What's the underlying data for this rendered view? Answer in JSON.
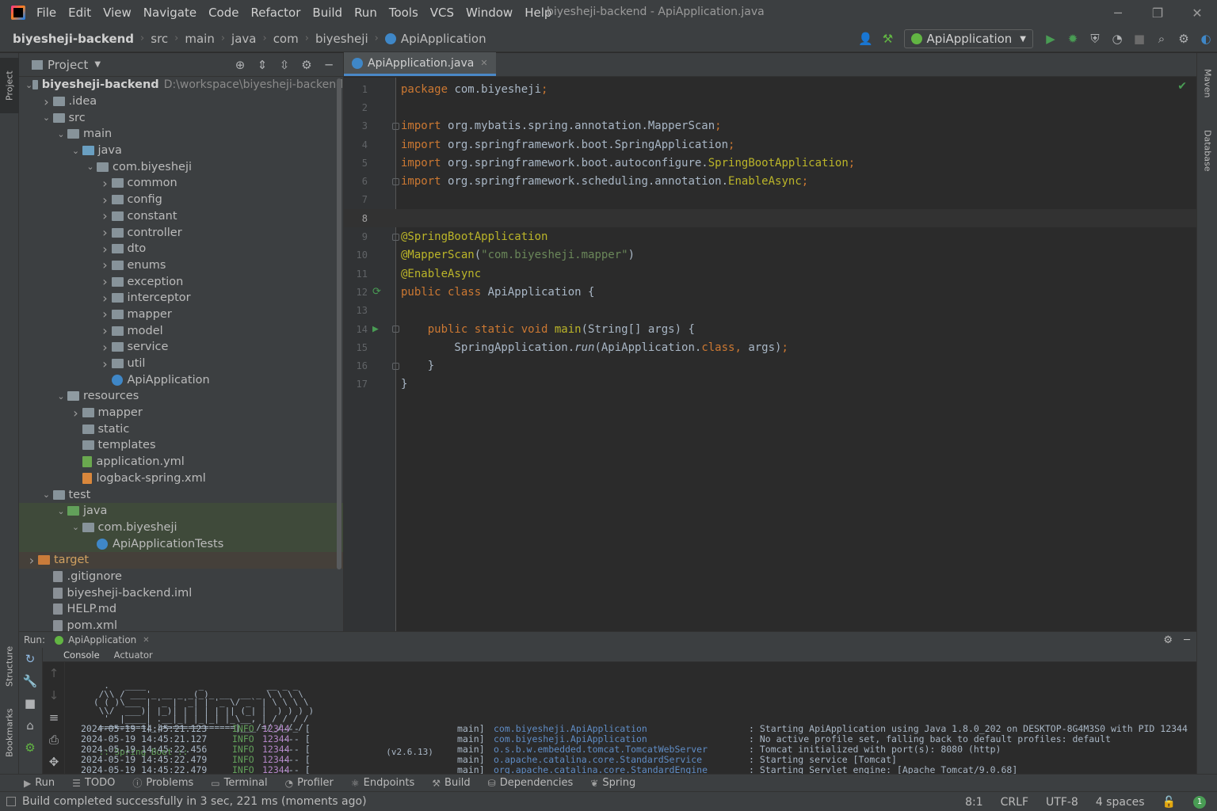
{
  "menubar": {
    "items": [
      "File",
      "Edit",
      "View",
      "Navigate",
      "Code",
      "Refactor",
      "Build",
      "Run",
      "Tools",
      "VCS",
      "Window",
      "Help"
    ],
    "window_title": "biyesheji-backend - ApiApplication.java"
  },
  "navbar": {
    "breadcrumbs": [
      "biyesheji-backend",
      "src",
      "main",
      "java",
      "com",
      "biyesheji",
      "ApiApplication"
    ],
    "run_config": "ApiApplication"
  },
  "project": {
    "title": "Project",
    "root_path": "D:\\workspace\\biyesheji-backend",
    "tree": [
      {
        "label": "biyesheji-backend",
        "depth": 0,
        "arrow": "v",
        "icon": "folder",
        "bold": true
      },
      {
        "label": ".idea",
        "depth": 1,
        "arrow": ">",
        "icon": "folder"
      },
      {
        "label": "src",
        "depth": 1,
        "arrow": "v",
        "icon": "folder"
      },
      {
        "label": "main",
        "depth": 2,
        "arrow": "v",
        "icon": "folder"
      },
      {
        "label": "java",
        "depth": 3,
        "arrow": "v",
        "icon": "folder-src"
      },
      {
        "label": "com.biyesheji",
        "depth": 4,
        "arrow": "v",
        "icon": "package"
      },
      {
        "label": "common",
        "depth": 5,
        "arrow": ">",
        "icon": "package"
      },
      {
        "label": "config",
        "depth": 5,
        "arrow": ">",
        "icon": "package"
      },
      {
        "label": "constant",
        "depth": 5,
        "arrow": ">",
        "icon": "package"
      },
      {
        "label": "controller",
        "depth": 5,
        "arrow": ">",
        "icon": "package"
      },
      {
        "label": "dto",
        "depth": 5,
        "arrow": ">",
        "icon": "package"
      },
      {
        "label": "enums",
        "depth": 5,
        "arrow": ">",
        "icon": "package"
      },
      {
        "label": "exception",
        "depth": 5,
        "arrow": ">",
        "icon": "package"
      },
      {
        "label": "interceptor",
        "depth": 5,
        "arrow": ">",
        "icon": "package"
      },
      {
        "label": "mapper",
        "depth": 5,
        "arrow": ">",
        "icon": "package"
      },
      {
        "label": "model",
        "depth": 5,
        "arrow": ">",
        "icon": "package"
      },
      {
        "label": "service",
        "depth": 5,
        "arrow": ">",
        "icon": "package"
      },
      {
        "label": "util",
        "depth": 5,
        "arrow": ">",
        "icon": "package"
      },
      {
        "label": "ApiApplication",
        "depth": 5,
        "arrow": "",
        "icon": "spring-class"
      },
      {
        "label": "resources",
        "depth": 2,
        "arrow": "v",
        "icon": "folder-res"
      },
      {
        "label": "mapper",
        "depth": 3,
        "arrow": ">",
        "icon": "folder"
      },
      {
        "label": "static",
        "depth": 3,
        "arrow": "",
        "icon": "folder"
      },
      {
        "label": "templates",
        "depth": 3,
        "arrow": "",
        "icon": "folder"
      },
      {
        "label": "application.yml",
        "depth": 3,
        "arrow": "",
        "icon": "yml"
      },
      {
        "label": "logback-spring.xml",
        "depth": 3,
        "arrow": "",
        "icon": "xml"
      },
      {
        "label": "test",
        "depth": 1,
        "arrow": "v",
        "icon": "folder"
      },
      {
        "label": "java",
        "depth": 2,
        "arrow": "v",
        "icon": "folder-test",
        "sel": true
      },
      {
        "label": "com.biyesheji",
        "depth": 3,
        "arrow": "v",
        "icon": "package",
        "sel": true
      },
      {
        "label": "ApiApplicationTests",
        "depth": 4,
        "arrow": "",
        "icon": "class",
        "sel": true
      },
      {
        "label": "target",
        "depth": 0,
        "arrow": ">",
        "icon": "folder-excl",
        "excl": true
      },
      {
        "label": ".gitignore",
        "depth": 1,
        "arrow": "",
        "icon": "file"
      },
      {
        "label": "biyesheji-backend.iml",
        "depth": 1,
        "arrow": "",
        "icon": "file"
      },
      {
        "label": "HELP.md",
        "depth": 1,
        "arrow": "",
        "icon": "file"
      },
      {
        "label": "pom.xml",
        "depth": 1,
        "arrow": "",
        "icon": "file"
      }
    ]
  },
  "editor": {
    "tab_label": "ApiApplication.java",
    "current_line": 8,
    "lines": [
      [
        {
          "t": "package ",
          "c": "kw"
        },
        {
          "t": "com.biyesheji",
          "c": "plain"
        },
        {
          "t": ";",
          "c": "kw"
        }
      ],
      [],
      [
        {
          "t": "import ",
          "c": "kw"
        },
        {
          "t": "org.mybatis.spring.annotation.MapperScan",
          "c": "plain"
        },
        {
          "t": ";",
          "c": "kw"
        }
      ],
      [
        {
          "t": "import ",
          "c": "kw"
        },
        {
          "t": "org.springframework.boot.SpringApplication",
          "c": "plain"
        },
        {
          "t": ";",
          "c": "kw"
        }
      ],
      [
        {
          "t": "import ",
          "c": "kw"
        },
        {
          "t": "org.springframework.boot.autoconfigure.",
          "c": "plain"
        },
        {
          "t": "SpringBootApplication",
          "c": "ann"
        },
        {
          "t": ";",
          "c": "kw"
        }
      ],
      [
        {
          "t": "import ",
          "c": "kw"
        },
        {
          "t": "org.springframework.scheduling.annotation.",
          "c": "plain"
        },
        {
          "t": "EnableAsync",
          "c": "ann"
        },
        {
          "t": ";",
          "c": "kw"
        }
      ],
      [],
      [],
      [
        {
          "t": "@SpringBootApplication",
          "c": "ann"
        }
      ],
      [
        {
          "t": "@MapperScan",
          "c": "ann"
        },
        {
          "t": "(",
          "c": "plain"
        },
        {
          "t": "\"com.biyesheji.mapper\"",
          "c": "str"
        },
        {
          "t": ")",
          "c": "plain"
        }
      ],
      [
        {
          "t": "@EnableAsync",
          "c": "ann"
        }
      ],
      [
        {
          "t": "public class ",
          "c": "kw"
        },
        {
          "t": "ApiApplication {",
          "c": "plain"
        }
      ],
      [],
      [
        {
          "t": "    public static void ",
          "c": "kw"
        },
        {
          "t": "main",
          "c": "ann"
        },
        {
          "t": "(String[] args) {",
          "c": "plain"
        }
      ],
      [
        {
          "t": "        SpringApplication.",
          "c": "plain"
        },
        {
          "t": "run",
          "c": "plain ital"
        },
        {
          "t": "(ApiApplication.",
          "c": "plain"
        },
        {
          "t": "class",
          "c": "kw"
        },
        {
          "t": ", ",
          "c": "kw"
        },
        {
          "t": "args)",
          "c": "plain"
        },
        {
          "t": ";",
          "c": "kw"
        }
      ],
      [
        {
          "t": "    }",
          "c": "plain"
        }
      ],
      [
        {
          "t": "}",
          "c": "plain"
        }
      ]
    ]
  },
  "run": {
    "label": "Run:",
    "config_tab": "ApiApplication",
    "subtabs": [
      "Console",
      "Actuator"
    ],
    "banner": "  .   ____          _            __ _ _\n /\\\\ / ___'_ __ _ _(_)_ __  __ _ \\ \\ \\ \\\n( ( )\\___ | '_ | '_| | '_ \\/ _` | \\ \\ \\ \\\n \\\\/  ___)| |_)| | | | | || (_| |  ) ) ) )\n  '  |____| .__|_| |_|_| |_\\__, | / / / /\n =========|_|==============|___/=/_/_/_/",
    "banner_label": " :: Spring Boot ::",
    "banner_version": "(v2.6.13)",
    "logs": [
      {
        "ts": "2024-05-19 14:45:21.123",
        "lvl": "INFO",
        "pid": "12344",
        "sep": "--- [",
        "thr": "main]",
        "logger": "com.biyesheji.ApiApplication",
        "msg": ": Starting ApiApplication using Java 1.8.0_202 on DESKTOP-8G4M3S0 with PID 12344"
      },
      {
        "ts": "2024-05-19 14:45:21.127",
        "lvl": "INFO",
        "pid": "12344",
        "sep": "--- [",
        "thr": "main]",
        "logger": "com.biyesheji.ApiApplication",
        "msg": ": No active profile set, falling back to default profiles: default"
      },
      {
        "ts": "2024-05-19 14:45:22.456",
        "lvl": "INFO",
        "pid": "12344",
        "sep": "--- [",
        "thr": "main]",
        "logger": "o.s.b.w.embedded.tomcat.TomcatWebServer",
        "msg": ": Tomcat initialized with port(s): 8080 (http)"
      },
      {
        "ts": "2024-05-19 14:45:22.479",
        "lvl": "INFO",
        "pid": "12344",
        "sep": "--- [",
        "thr": "main]",
        "logger": "o.apache.catalina.core.StandardService",
        "msg": ": Starting service [Tomcat]"
      },
      {
        "ts": "2024-05-19 14:45:22.479",
        "lvl": "INFO",
        "pid": "12344",
        "sep": "--- [",
        "thr": "main]",
        "logger": "org.apache.catalina.core.StandardEngine",
        "msg": ": Starting Servlet engine: [Apache Tomcat/9.0.68]"
      }
    ]
  },
  "bottom_tabs": [
    "Run",
    "TODO",
    "Problems",
    "Terminal",
    "Profiler",
    "Endpoints",
    "Build",
    "Dependencies",
    "Spring"
  ],
  "status": {
    "message": "Build completed successfully in 3 sec, 221 ms (moments ago)",
    "position": "8:1",
    "line_sep": "CRLF",
    "encoding": "UTF-8",
    "indent": "4 spaces",
    "notifications": "1"
  },
  "stripes": {
    "left": [
      "Project",
      "Structure",
      "Bookmarks"
    ],
    "right": [
      "Maven",
      "Database"
    ]
  },
  "colors": {
    "accent": "#4a88c7",
    "keyword": "#cc7832",
    "annotation": "#bbb529",
    "string": "#6a8759",
    "run_green": "#499c54"
  }
}
